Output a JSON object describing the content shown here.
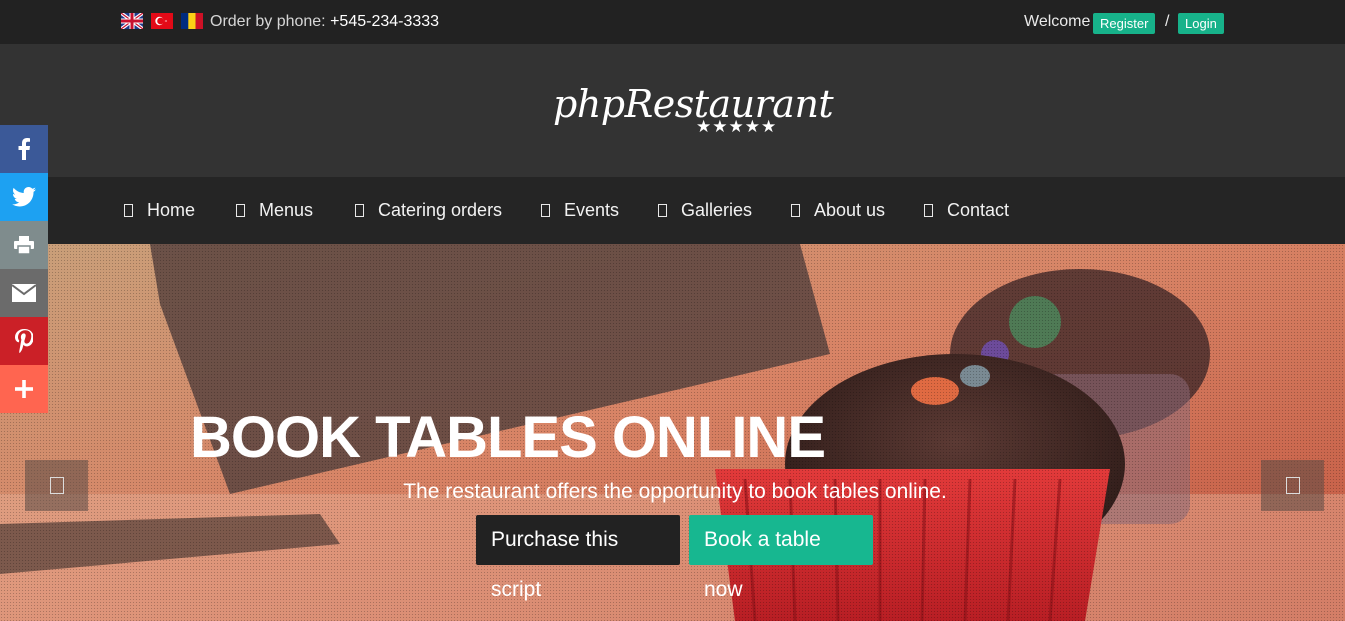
{
  "topbar": {
    "flags": [
      "uk-flag-icon",
      "turkey-flag-icon",
      "romania-flag-icon"
    ],
    "phone_label": "Order by phone:",
    "phone_number": "+545-234-3333",
    "welcome": "Welcome",
    "register": "Register",
    "slash": "/",
    "login": "Login"
  },
  "header": {
    "logo_text": "phpRestaurant",
    "logo_stars": "★★★★★"
  },
  "nav": {
    "items": [
      {
        "label": "Home"
      },
      {
        "label": "Menus"
      },
      {
        "label": "Catering orders"
      },
      {
        "label": "Events"
      },
      {
        "label": "Galleries"
      },
      {
        "label": "About us"
      },
      {
        "label": "Contact"
      }
    ]
  },
  "hero": {
    "title": "BOOK TABLES ONLINE",
    "subtitle": "The restaurant offers the opportunity to book tables online.",
    "btn_purchase": "Purchase this script",
    "btn_book": "Book a table now"
  },
  "social": {
    "icons": [
      "facebook-icon",
      "twitter-icon",
      "print-icon",
      "email-icon",
      "pinterest-icon",
      "plus-icon"
    ]
  },
  "colors": {
    "accent": "#17b28a",
    "topbar_bg": "#222222",
    "header_bg": "#333333",
    "nav_bg": "#252525"
  }
}
